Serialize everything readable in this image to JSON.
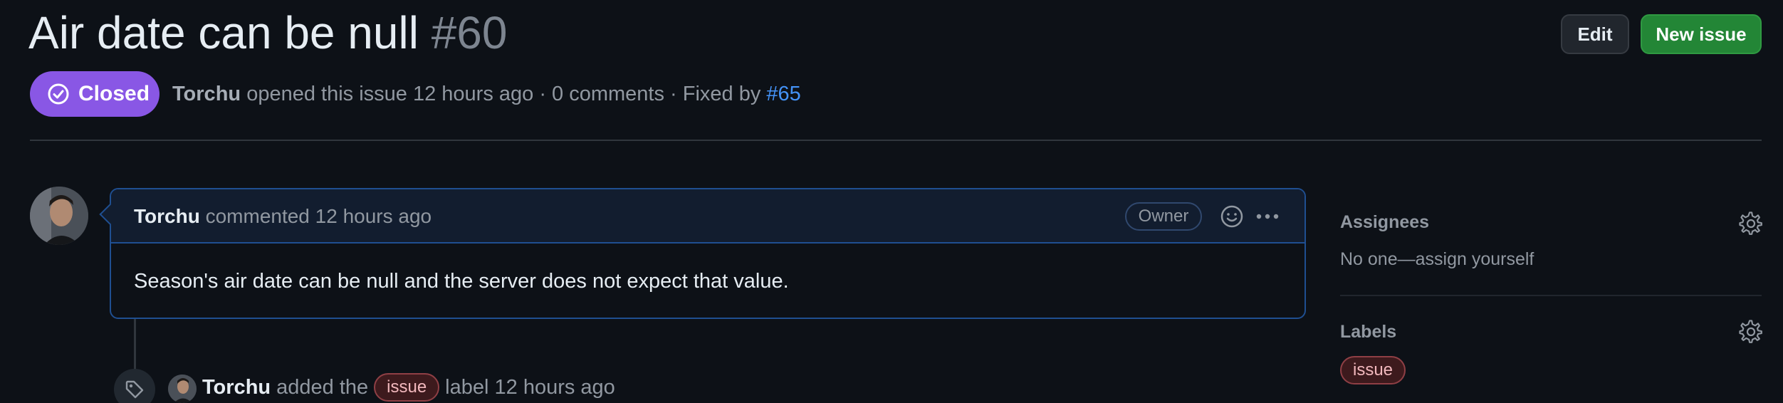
{
  "issue": {
    "title": "Air date can be null",
    "number": "#60",
    "state": "Closed",
    "meta": {
      "author": "Torchu",
      "opened_text": "opened this issue 12 hours ago · 0 comments · Fixed by",
      "fixed_by": "#65"
    }
  },
  "header_actions": {
    "edit_label": "Edit",
    "new_issue_label": "New issue"
  },
  "comment": {
    "author": "Torchu",
    "action": "commented 12 hours ago",
    "role_badge": "Owner",
    "body": "Season's air date can be null and the server does not expect that value."
  },
  "timeline_event": {
    "author": "Torchu",
    "text_before": "added the",
    "label": "issue",
    "text_after": "label 12 hours ago",
    "icon": "tag-icon"
  },
  "sidebar": {
    "assignees": {
      "heading": "Assignees",
      "value": "No one—assign yourself"
    },
    "labels": {
      "heading": "Labels",
      "items": [
        "issue"
      ]
    }
  },
  "colors": {
    "background": "#0d1117",
    "closed_purple": "#8957e5",
    "primary_green": "#238636",
    "link_blue": "#4493f8",
    "comment_border": "#1f4f91",
    "label_red_bg": "#3d1a1d",
    "label_red_text": "#f2b8bd"
  }
}
